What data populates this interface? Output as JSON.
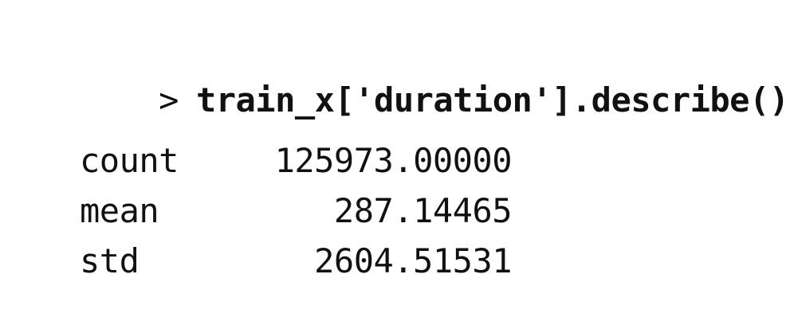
{
  "console": {
    "prompt": ">",
    "command": "train_x['duration'].describe()",
    "output": [
      {
        "name": "count",
        "value": "125973.00000"
      },
      {
        "name": "mean",
        "value": "287.14465"
      },
      {
        "name": "std",
        "value": "2604.51531"
      }
    ]
  },
  "colors": {
    "background": "#ffffff",
    "text": "#111111"
  }
}
